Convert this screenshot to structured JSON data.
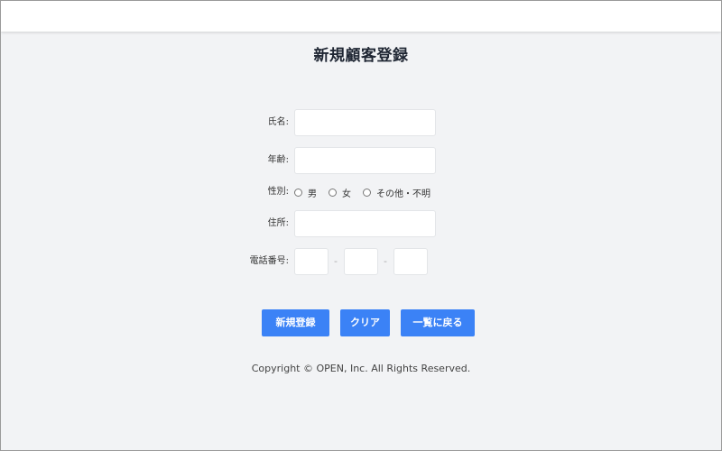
{
  "page": {
    "title": "新規顧客登録"
  },
  "form": {
    "name_label": "氏名:",
    "age_label": "年齢:",
    "gender_label": "性別:",
    "gender_options": [
      "男",
      "女",
      "その他・不明"
    ],
    "address_label": "住所:",
    "phone_label": "電話番号:",
    "phone_separator": "-"
  },
  "buttons": {
    "register": "新規登録",
    "clear": "クリア",
    "back": "一覧に戻る"
  },
  "footer": {
    "copyright": "Copyright © OPEN, Inc. All Rights Reserved."
  },
  "colors": {
    "accent": "#3b82f6",
    "background": "#f2f3f5",
    "topbar": "#ffffff"
  }
}
